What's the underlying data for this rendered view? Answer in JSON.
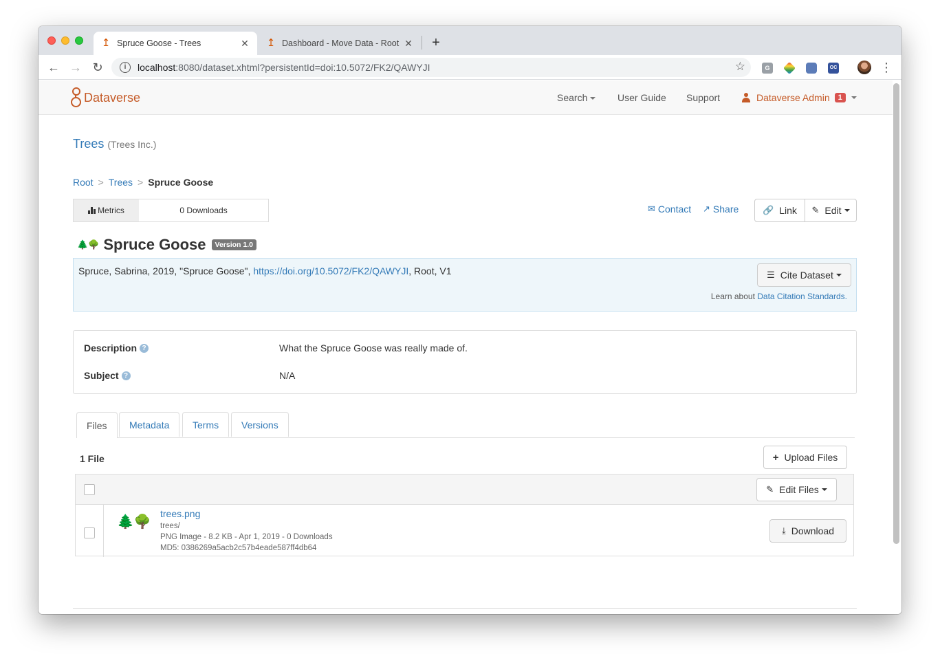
{
  "browser": {
    "tabs": [
      {
        "title": "Spruce Goose - Trees"
      },
      {
        "title": "Dashboard - Move Data - Root"
      }
    ],
    "url_host": "localhost",
    "url_rest": ":8080/dataset.xhtml?persistentId=doi:10.5072/FK2/QAWYJI",
    "extensions": [
      "G",
      "OC"
    ]
  },
  "navbar": {
    "brand": "Dataverse",
    "search": "Search",
    "user_guide": "User Guide",
    "support": "Support",
    "user": "Dataverse Admin",
    "notifications": "1"
  },
  "dataverse": {
    "name": "Trees",
    "affiliation": "(Trees Inc.)"
  },
  "breadcrumb": {
    "root": "Root",
    "parent": "Trees",
    "current": "Spruce Goose",
    "sep": ">"
  },
  "metrics": {
    "label": "Metrics",
    "downloads": "0 Downloads"
  },
  "actions": {
    "contact": "Contact",
    "share": "Share",
    "link": "Link",
    "edit": "Edit"
  },
  "dataset": {
    "title": "Spruce Goose",
    "version": "Version 1.0",
    "citation_before": "Spruce, Sabrina, 2019, \"Spruce Goose\", ",
    "citation_doi": "https://doi.org/10.5072/FK2/QAWYJI",
    "citation_after": ", Root, V1",
    "cite_button": "Cite Dataset",
    "learn_about": "Learn about ",
    "learn_link": "Data Citation Standards."
  },
  "metadata": {
    "description_label": "Description",
    "description_value": "What the Spruce Goose was really made of.",
    "subject_label": "Subject",
    "subject_value": "N/A"
  },
  "tabs": {
    "files": "Files",
    "metadata": "Metadata",
    "terms": "Terms",
    "versions": "Versions"
  },
  "files": {
    "count": "1 File",
    "upload": "Upload Files",
    "edit_files": "Edit Files",
    "items": [
      {
        "name": "trees.png",
        "path": "trees/",
        "meta": "PNG Image - 8.2 KB - Apr 1, 2019 - 0 Downloads",
        "md5": "MD5: 0386269a5acb2c57b4eade587ff4db64",
        "download": "Download"
      }
    ]
  },
  "colors": {
    "brand": "#c55b28",
    "link": "#337ab7",
    "badge": "#d9534f"
  }
}
